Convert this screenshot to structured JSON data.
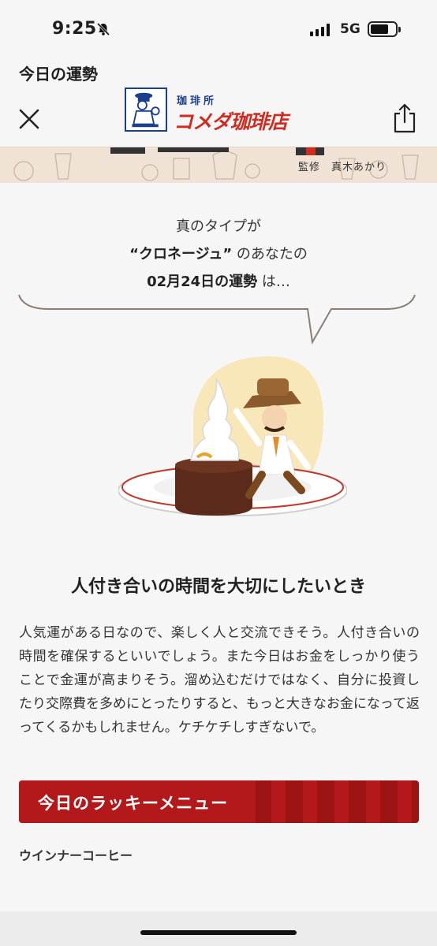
{
  "status_bar": {
    "time": "9:25",
    "network": "5G",
    "icons": [
      "bell-slash-icon",
      "signal-icon",
      "battery-icon"
    ]
  },
  "nav": {
    "title": "今日の運勢",
    "close_icon": "close-icon",
    "share_icon": "share-icon"
  },
  "logo": {
    "top": "珈琲所",
    "main": "コメダ珈琲店"
  },
  "header": {
    "supervisor": "監修　真木あかり"
  },
  "intro": {
    "line1": "真のタイプが",
    "type_name": "“クロネージュ”",
    "line2_suffix": "のあなたの",
    "date": "02月24日の運勢",
    "line3_suffix": "は…"
  },
  "fortune": {
    "headline": "人付き合いの時間を大切にしたいとき",
    "body": "人気運がある日なので、楽しく人と交流できそう。人付き合いの時間を確保するといいでしょう。また今日はお金をしっかり使うことで金運が高まりそう。溜め込むだけではなく、自分に投資したり交際費を多めにとったりすると、もっと大きなお金になって返ってくるかもしれません。ケチケチしすぎないで。"
  },
  "lucky": {
    "title": "今日のラッキーメニュー",
    "item": "ウインナーコーヒー"
  },
  "colors": {
    "accent_red": "#b3191a",
    "logo_red": "#d32a1f",
    "logo_blue": "#1b3f8f",
    "strip_beige": "#f0e2d4"
  }
}
